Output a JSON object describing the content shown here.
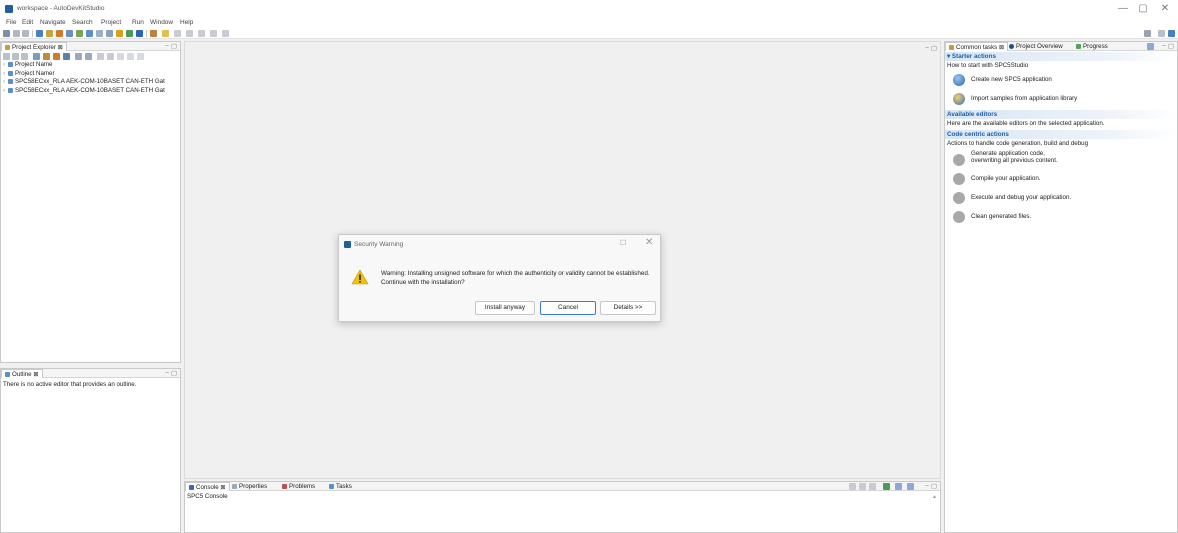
{
  "window": {
    "title": "workspace - AutoDevKitStudio",
    "minimize": "—",
    "maximize": "▢",
    "close": "✕"
  },
  "menu": [
    "File",
    "Edit",
    "Navigate",
    "Search",
    "Project",
    "Run",
    "Window",
    "Help"
  ],
  "project_explorer": {
    "tab_label": "Project Explorer ⊠",
    "minmax": "− ▢",
    "items": [
      "Project Name",
      "Project Namer",
      "SPC58ECxx_RLA AEK-COM-10BASET CAN-ETH Gat",
      "SPC58ECxx_RLA AEK-COM-10BASET CAN-ETH Gat"
    ]
  },
  "outline": {
    "tab_label": "Outline ⊠",
    "minmax": "− ▢",
    "message": "There is no active editor that provides an outline."
  },
  "editor": {
    "minmax": "− ▢"
  },
  "right_panel": {
    "tabs": [
      "Common tasks ⊠",
      "Project Overview",
      "Progress"
    ],
    "minmax": "− ▢",
    "starter": {
      "heading": "▾ Starter actions",
      "description": "How to start with SPC5Studio",
      "actions": [
        "Create new SPC5 application",
        "Import samples from application library"
      ]
    },
    "editors": {
      "heading": "Available editors",
      "description": "Here are the available editors on the selected application."
    },
    "code": {
      "heading": "Code centric actions",
      "description": "Actions to handle code generation, build and debug",
      "generate_line1": "Generate application code,",
      "generate_line2": "overwriting all previous content.",
      "compile": "Compile your application.",
      "execute": "Execute and debug your application.",
      "clean": "Clean generated files."
    }
  },
  "console": {
    "tabs": [
      "Console ⊠",
      "Properties",
      "Problems",
      "Tasks"
    ],
    "minmax": "− ▢",
    "title": "SPC5 Console",
    "scroll_up": "▲"
  },
  "dialog": {
    "title": "Security Warning",
    "maximize": "☐",
    "close": "✕",
    "message": "Warning: Installing unsigned software for which the authenticity or validity cannot be established. Continue with the installation?",
    "buttons": {
      "install": "Install anyway",
      "cancel": "Cancel",
      "details": "Details >>"
    }
  },
  "colors": {
    "accent": "#1a5fa8",
    "warning": "#f2c200",
    "default_button_border": "#3b78d8"
  }
}
